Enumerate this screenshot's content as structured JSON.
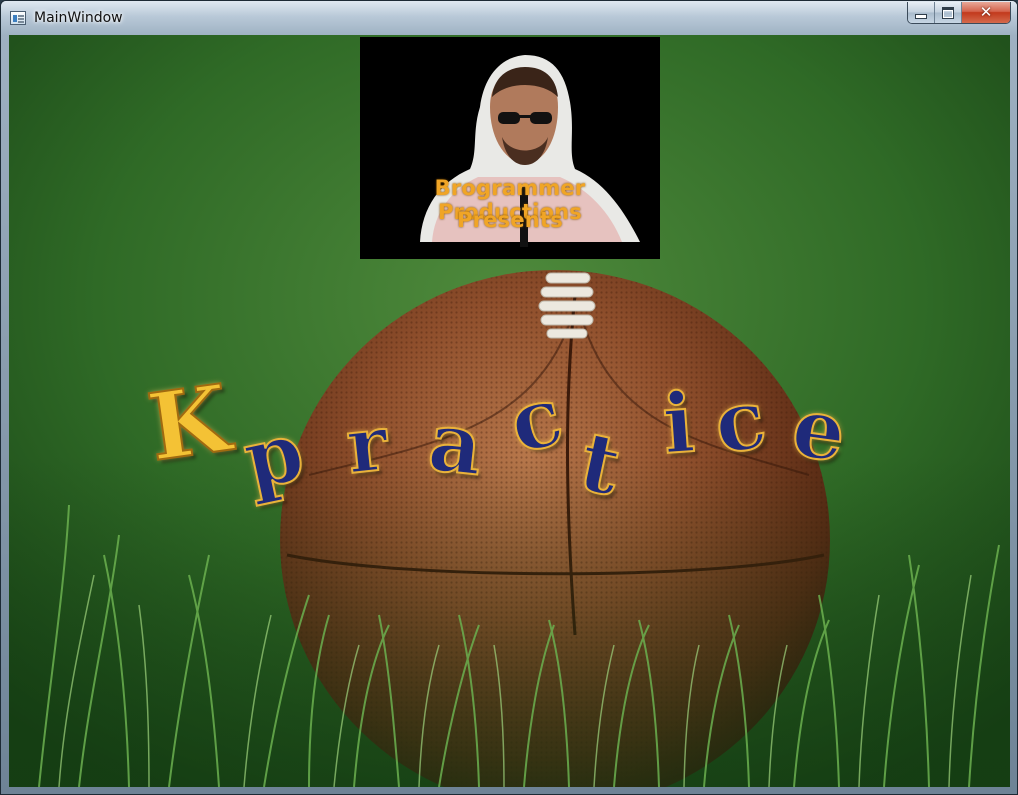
{
  "window": {
    "title": "MainWindow",
    "icon": "application-window-icon",
    "buttons": {
      "minimize": "minimize-icon",
      "maximize": "maximize-icon",
      "close": "close-icon"
    }
  },
  "splash": {
    "background": "football-in-grass",
    "banner": {
      "line1": "Brogrammer Productions",
      "line2": "Presents",
      "text_color": "#f0a526"
    },
    "logo": {
      "text": "Kpractice",
      "letters": [
        "K",
        "p",
        "r",
        "a",
        "c",
        "t",
        "i",
        "c",
        "e"
      ],
      "colors": {
        "first_letter": "#f4c235",
        "letters": "#1f2a7a",
        "outline": "#e9b23a"
      }
    }
  }
}
